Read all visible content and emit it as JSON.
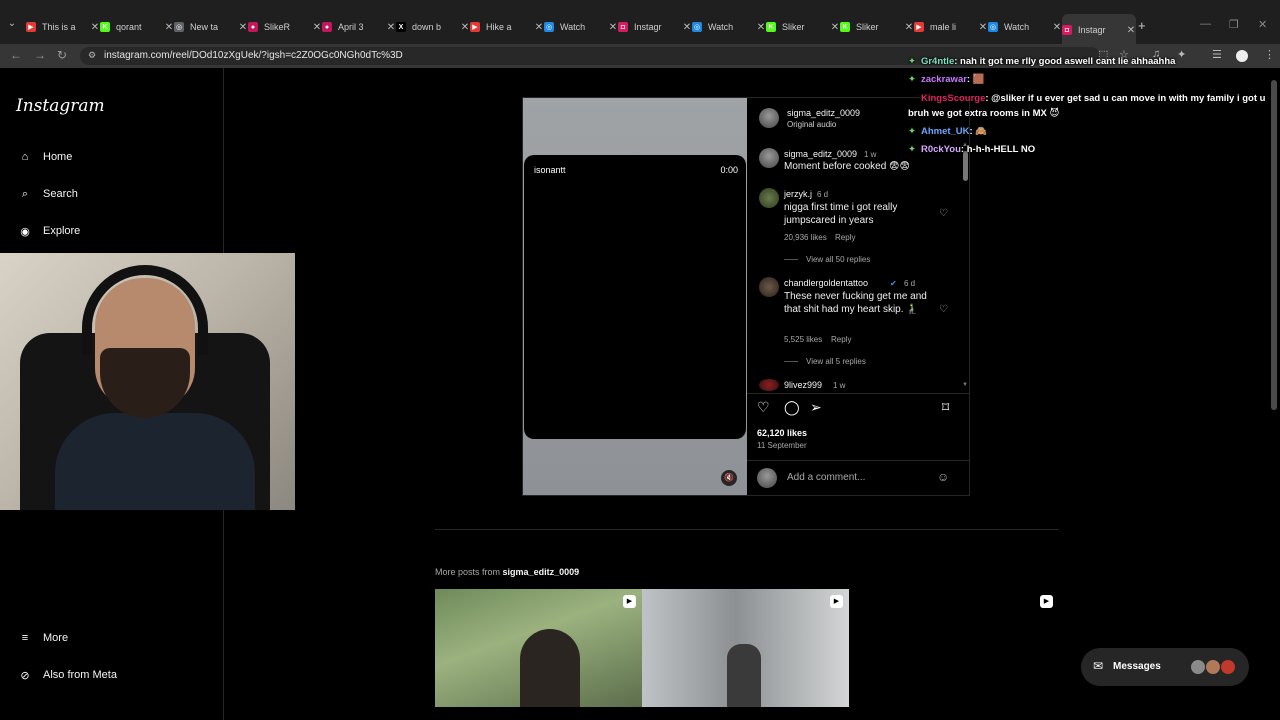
{
  "browser": {
    "tabs": [
      {
        "title": "This is a",
        "fav_color": "#e53935",
        "fav_glyph": "▶"
      },
      {
        "title": "qorant",
        "fav_color": "#53fc18",
        "fav_glyph": "K"
      },
      {
        "title": "New ta",
        "fav_color": "#5f6368",
        "fav_glyph": "◎"
      },
      {
        "title": "SlikeR",
        "fav_color": "#c2185b",
        "fav_glyph": "●"
      },
      {
        "title": "April 3",
        "fav_color": "#c2185b",
        "fav_glyph": "●"
      },
      {
        "title": "down b",
        "fav_color": "#000000",
        "fav_glyph": "X"
      },
      {
        "title": "Hike a",
        "fav_color": "#e53935",
        "fav_glyph": "▶"
      },
      {
        "title": "Watch",
        "fav_color": "#1e88e5",
        "fav_glyph": "◎"
      },
      {
        "title": "Instagr",
        "fav_color": "#d81b60",
        "fav_glyph": "◘"
      },
      {
        "title": "Watch",
        "fav_color": "#1e88e5",
        "fav_glyph": "◎"
      },
      {
        "title": "Sliker",
        "fav_color": "#53fc18",
        "fav_glyph": "K"
      },
      {
        "title": "Sliker",
        "fav_color": "#53fc18",
        "fav_glyph": "K"
      },
      {
        "title": "male li",
        "fav_color": "#e53935",
        "fav_glyph": "▶"
      },
      {
        "title": "Watch",
        "fav_color": "#1e88e5",
        "fav_glyph": "◎"
      },
      {
        "title": "Instagr",
        "fav_color": "#d81b60",
        "fav_glyph": "◘"
      }
    ],
    "url": "instagram.com/reel/DOd10zXgUek/?igsh=c2Z0OGc0NGh0dTc%3D"
  },
  "sidebar": {
    "logo": "Instagram",
    "items": [
      {
        "label": "Home",
        "icon": "home-icon",
        "glyph": "⌂"
      },
      {
        "label": "Search",
        "icon": "search-icon",
        "glyph": "⌕"
      },
      {
        "label": "Explore",
        "icon": "compass-icon",
        "glyph": "◉"
      }
    ],
    "bottom": [
      {
        "label": "More",
        "icon": "menu-icon",
        "glyph": "≡"
      },
      {
        "label": "Also from Meta",
        "icon": "meta-icon",
        "glyph": "⊘"
      }
    ]
  },
  "post": {
    "author": "sigma_editz_0009",
    "audio": "Original audio",
    "media_user": "isonantt",
    "media_time": "0:00",
    "caption": {
      "user": "sigma_editz_0009",
      "age": "1 w",
      "text": "Moment before cooked 😨😨"
    },
    "comments": [
      {
        "user": "jerzyk.j",
        "age": "6 d",
        "text": "nigga first time i got really jumpscared in years",
        "likes": "20,936 likes",
        "reply": "Reply",
        "view": "View all 50 replies"
      },
      {
        "user": "chandlergoldentattoo",
        "age": "6 d",
        "text": "These never fucking get me and that shit had my heart skip. 🧎‍♂️",
        "likes": "5,525 likes",
        "reply": "Reply",
        "view": "View all 5 replies"
      },
      {
        "user": "9livez999",
        "age": "1 w"
      }
    ],
    "likes": "62,120 likes",
    "date": "11 September",
    "comment_placeholder": "Add a comment..."
  },
  "more": {
    "prefix": "More posts from",
    "user": "sigma_editz_0009"
  },
  "messages": {
    "label": "Messages"
  },
  "chat": [
    {
      "user": "Gr4ntle",
      "color": "#7fe0c0",
      "text": ": nah it got me rlly good aswell cant lie ahhaahha"
    },
    {
      "user": "zackrawar",
      "color": "#c879ff",
      "text": ": 🟫"
    },
    {
      "user": "KingsScourge",
      "color": "#e0245e",
      "text": ": @sliker if u ever get sad u can move in with my family i got u"
    },
    {
      "user": "",
      "color": "#ffffff",
      "text": "bruh we got extra rooms in MX 😈"
    },
    {
      "user": "Ahmet_UK",
      "color": "#6aa7ff",
      "text": ": 🙈"
    },
    {
      "user": "R0ckYou",
      "color": "#d6a8ff",
      "text": ": h-h-h-HELL NO"
    }
  ]
}
